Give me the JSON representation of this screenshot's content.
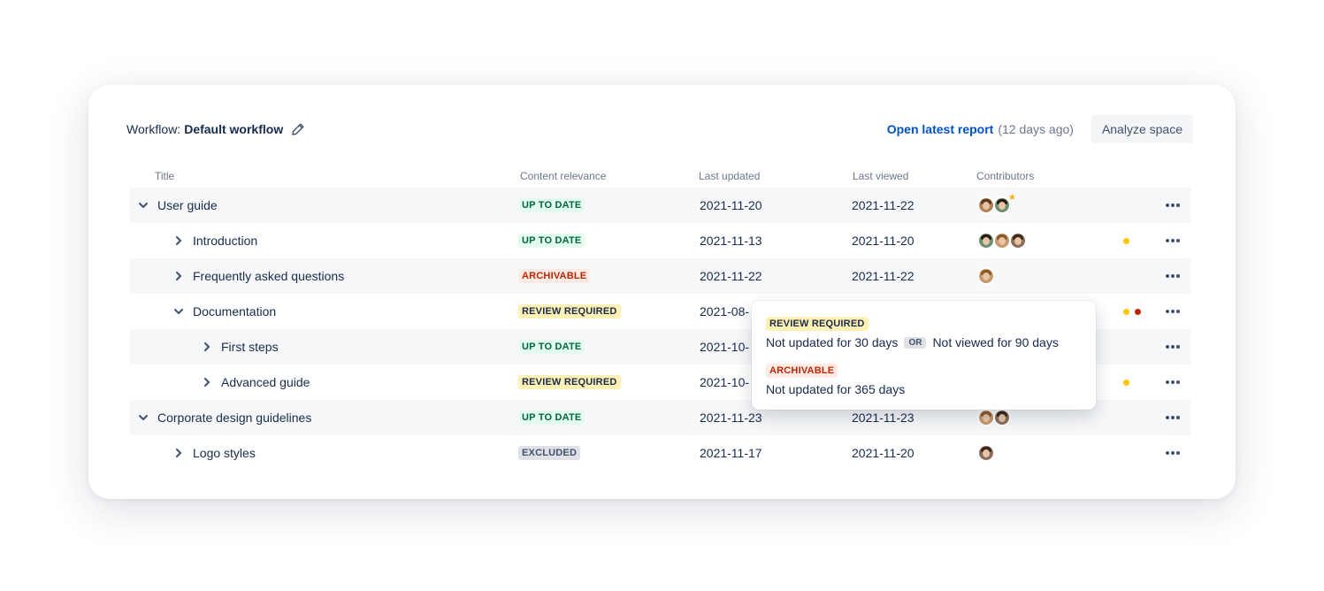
{
  "workflow": {
    "label": "Workflow:",
    "name": "Default workflow"
  },
  "report": {
    "link_text": "Open latest report",
    "ago": "(12 days ago)"
  },
  "analyze_button": "Analyze space",
  "columns": {
    "title": "Title",
    "relevance": "Content relevance",
    "last_updated": "Last updated",
    "last_viewed": "Last viewed",
    "contributors": "Contributors"
  },
  "statuses": {
    "up_to_date": {
      "label": "UP TO DATE",
      "bg": "#e3fcef",
      "fg": "#006644"
    },
    "archivable": {
      "label": "ARCHIVABLE",
      "bg": "#ffebe6",
      "fg": "#bf2600"
    },
    "review_required": {
      "label": "REVIEW REQUIRED",
      "bg": "#fff0b3",
      "fg": "#172b4d"
    },
    "excluded": {
      "label": "EXCLUDED",
      "bg": "#dfe1e6",
      "fg": "#42526e"
    }
  },
  "rows": [
    {
      "title": "User guide",
      "level": 0,
      "chevron": "chevron-down-icon",
      "status": "up_to_date",
      "updated": "2021-11-20",
      "viewed": "2021-11-22",
      "contributors": 2,
      "star": true,
      "dots": [],
      "shaded": true
    },
    {
      "title": "Introduction",
      "level": 1,
      "chevron": "chevron-right-icon",
      "status": "up_to_date",
      "updated": "2021-11-13",
      "viewed": "2021-11-20",
      "contributors": 3,
      "star": false,
      "dots": [
        "#ffc400"
      ],
      "shaded": false
    },
    {
      "title": "Frequently asked questions",
      "level": 1,
      "chevron": "chevron-right-icon",
      "status": "archivable",
      "updated": "2021-11-22",
      "viewed": "2021-11-22",
      "contributors": 1,
      "star": false,
      "dots": [],
      "shaded": true
    },
    {
      "title": "Documentation",
      "level": 1,
      "chevron": "chevron-down-icon",
      "status": "review_required",
      "updated": "2021-08-",
      "viewed": "",
      "contributors": 0,
      "star": false,
      "dots": [
        "#ffc400",
        "#bf2600"
      ],
      "shaded": false
    },
    {
      "title": "First steps",
      "level": 2,
      "chevron": "chevron-right-icon",
      "status": "up_to_date",
      "updated": "2021-10-",
      "viewed": "",
      "contributors": 0,
      "star": false,
      "dots": [],
      "shaded": true
    },
    {
      "title": "Advanced guide",
      "level": 2,
      "chevron": "chevron-right-icon",
      "status": "review_required",
      "updated": "2021-10-",
      "viewed": "",
      "contributors": 0,
      "star": false,
      "dots": [
        "#ffc400"
      ],
      "shaded": false
    },
    {
      "title": "Corporate design guidelines",
      "level": 0,
      "chevron": "chevron-down-icon",
      "status": "up_to_date",
      "updated": "2021-11-23",
      "viewed": "2021-11-23",
      "contributors": 2,
      "star": false,
      "dots": [],
      "shaded": true
    },
    {
      "title": "Logo styles",
      "level": 1,
      "chevron": "chevron-right-icon",
      "status": "excluded",
      "updated": "2021-11-17",
      "viewed": "2021-11-20",
      "contributors": 1,
      "star": false,
      "dots": [],
      "shaded": false
    }
  ],
  "tooltip": {
    "review_label": "REVIEW REQUIRED",
    "review_part1": "Not updated for 30 days",
    "or_label": "OR",
    "review_part2": "Not viewed for 90 days",
    "archivable_label": "ARCHIVABLE",
    "archivable_text": "Not updated for 365 days"
  },
  "colors": {
    "link": "#0052cc",
    "text": "#172b4d",
    "muted": "#6b778c",
    "row_shade": "#f7f8f9"
  }
}
